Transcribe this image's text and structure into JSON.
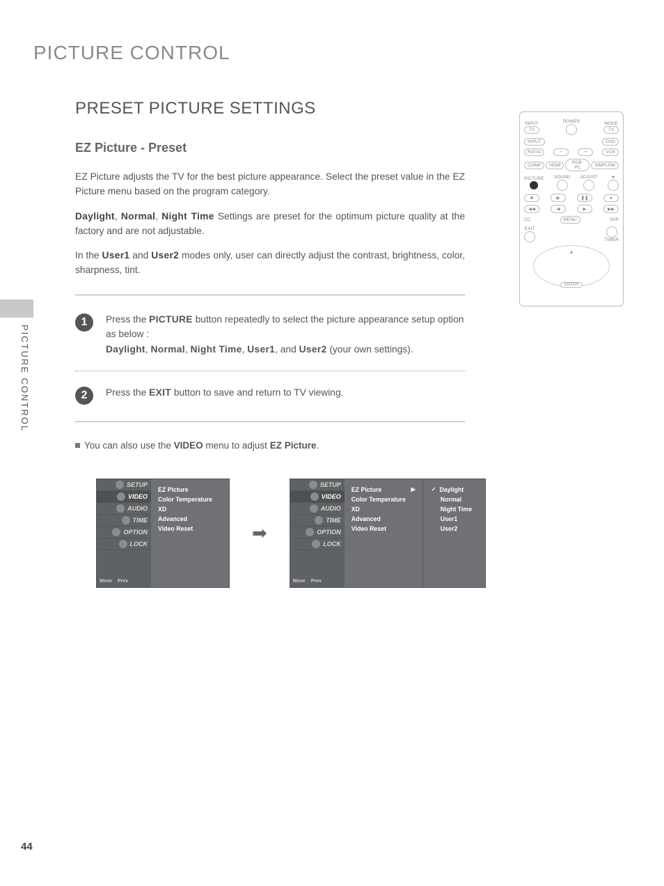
{
  "page_number": "44",
  "side_tab": "PICTURE CONTROL",
  "main_title": "PICTURE CONTROL",
  "sub_title": "PRESET PICTURE SETTINGS",
  "section_title": "EZ Picture - Preset",
  "para1": "EZ Picture adjusts the TV for the best picture appearance. Select the preset value in the EZ Picture menu based on the program category.",
  "para2_pre": "Daylight",
  "para2_mid1": ", ",
  "para2_b2": "Normal",
  "para2_mid2": ", ",
  "para2_b3": "Night Time",
  "para2_tail": " Settings are preset for the optimum picture quality at the factory and are not adjustable.",
  "para3_pre": "In the ",
  "para3_b1": "User1",
  "para3_mid": " and ",
  "para3_b2": "User2",
  "para3_tail": " modes only, user can directly adjust the contrast, brightness, color, sharpness, tint.",
  "step1_badge": "1",
  "step1_l1_pre": "Press the ",
  "step1_l1_b": "PICTURE",
  "step1_l1_tail": " button repeatedly to select the picture appearance setup option as below :",
  "step1_l2_b1": "Daylight",
  "step1_l2_s1": ", ",
  "step1_l2_b2": "Normal",
  "step1_l2_s2": ", ",
  "step1_l2_b3": "Night Time",
  "step1_l2_s3": ", ",
  "step1_l2_b4": "User1",
  "step1_l2_s4": ", and ",
  "step1_l2_b5": "User2",
  "step1_l2_tail": " (your own settings).",
  "step2_badge": "2",
  "step2_pre": "Press the ",
  "step2_b": "EXIT",
  "step2_tail": " button to save and return to TV viewing.",
  "note_pre": "You can also use the ",
  "note_b1": "VIDEO",
  "note_mid": " menu to adjust ",
  "note_b2": "EZ Picture",
  "note_tail": ".",
  "remote": {
    "input": "INPUT",
    "mode": "MODE",
    "tv": "TV",
    "power": "POWER",
    "dvd": "DVD",
    "ratio": "RATIO",
    "vcr": "VCR",
    "comp": "COMP",
    "hdmi": "HDMI",
    "rgbpc": "RGB-PC",
    "simplink": "SIMPLINK",
    "picture": "PICTURE",
    "sound": "SOUND",
    "adjust": "ADJUST",
    "cc": "CC",
    "menu": "MENU",
    "sap": "SAP",
    "exit": "EXIT",
    "timer": "TIMER",
    "enter": "ENTER"
  },
  "osd": {
    "sidebar": [
      "SETUP",
      "VIDEO",
      "AUDIO",
      "TIME",
      "OPTION",
      "LOCK"
    ],
    "footer_move": "Move",
    "footer_prev": "Prev",
    "main": [
      "EZ Picture",
      "Color Temperature",
      "XD",
      "Advanced",
      "Video Reset"
    ],
    "sub": [
      "Daylight",
      "Normal",
      "Night Time",
      "User1",
      "User2"
    ],
    "arrow": "▶",
    "transition": "➡"
  }
}
